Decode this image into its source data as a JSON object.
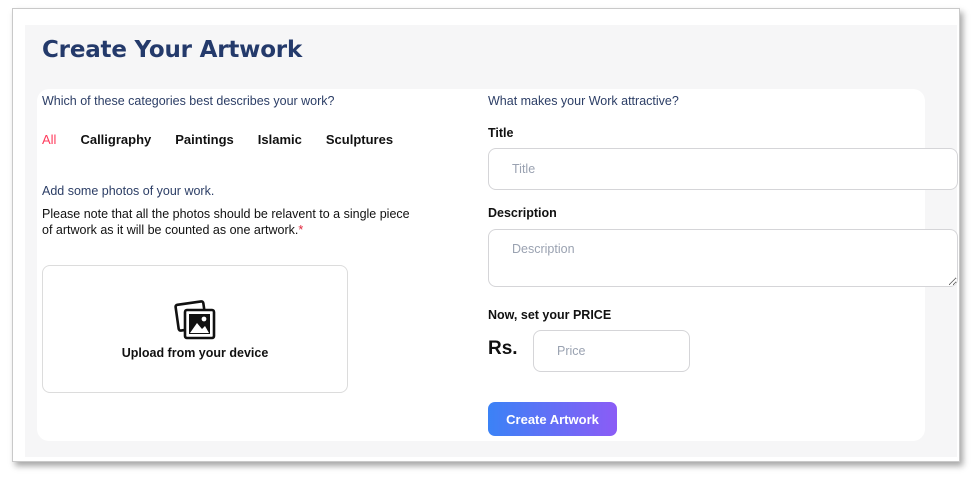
{
  "page": {
    "title": "Create Your Artwork"
  },
  "categories": {
    "question": "Which of these categories best describes your work?",
    "items": [
      "All",
      "Calligraphy",
      "Paintings",
      "Islamic",
      "Sculptures"
    ],
    "selected": "All"
  },
  "photos": {
    "question": "Add some photos of your work.",
    "note": "Please note that all the photos should be relavent to a single piece of artwork as it will be counted as one artwork.",
    "required_mark": "*",
    "upload_label": "Upload from your device",
    "upload_icon": "images-icon"
  },
  "details": {
    "question": "What makes your Work attractive?",
    "title_label": "Title",
    "title_placeholder": "Title",
    "title_value": "",
    "description_label": "Description",
    "description_placeholder": "Description",
    "description_value": "",
    "price_label": "Now, set your PRICE",
    "currency": "Rs.",
    "price_placeholder": "Price",
    "price_value": ""
  },
  "actions": {
    "create_label": "Create Artwork"
  },
  "colors": {
    "title": "#243a6b",
    "active_category": "#ff3b5c",
    "required": "#e0243a",
    "button_gradient_start": "#3b82f6",
    "button_gradient_end": "#8b5cf6"
  }
}
